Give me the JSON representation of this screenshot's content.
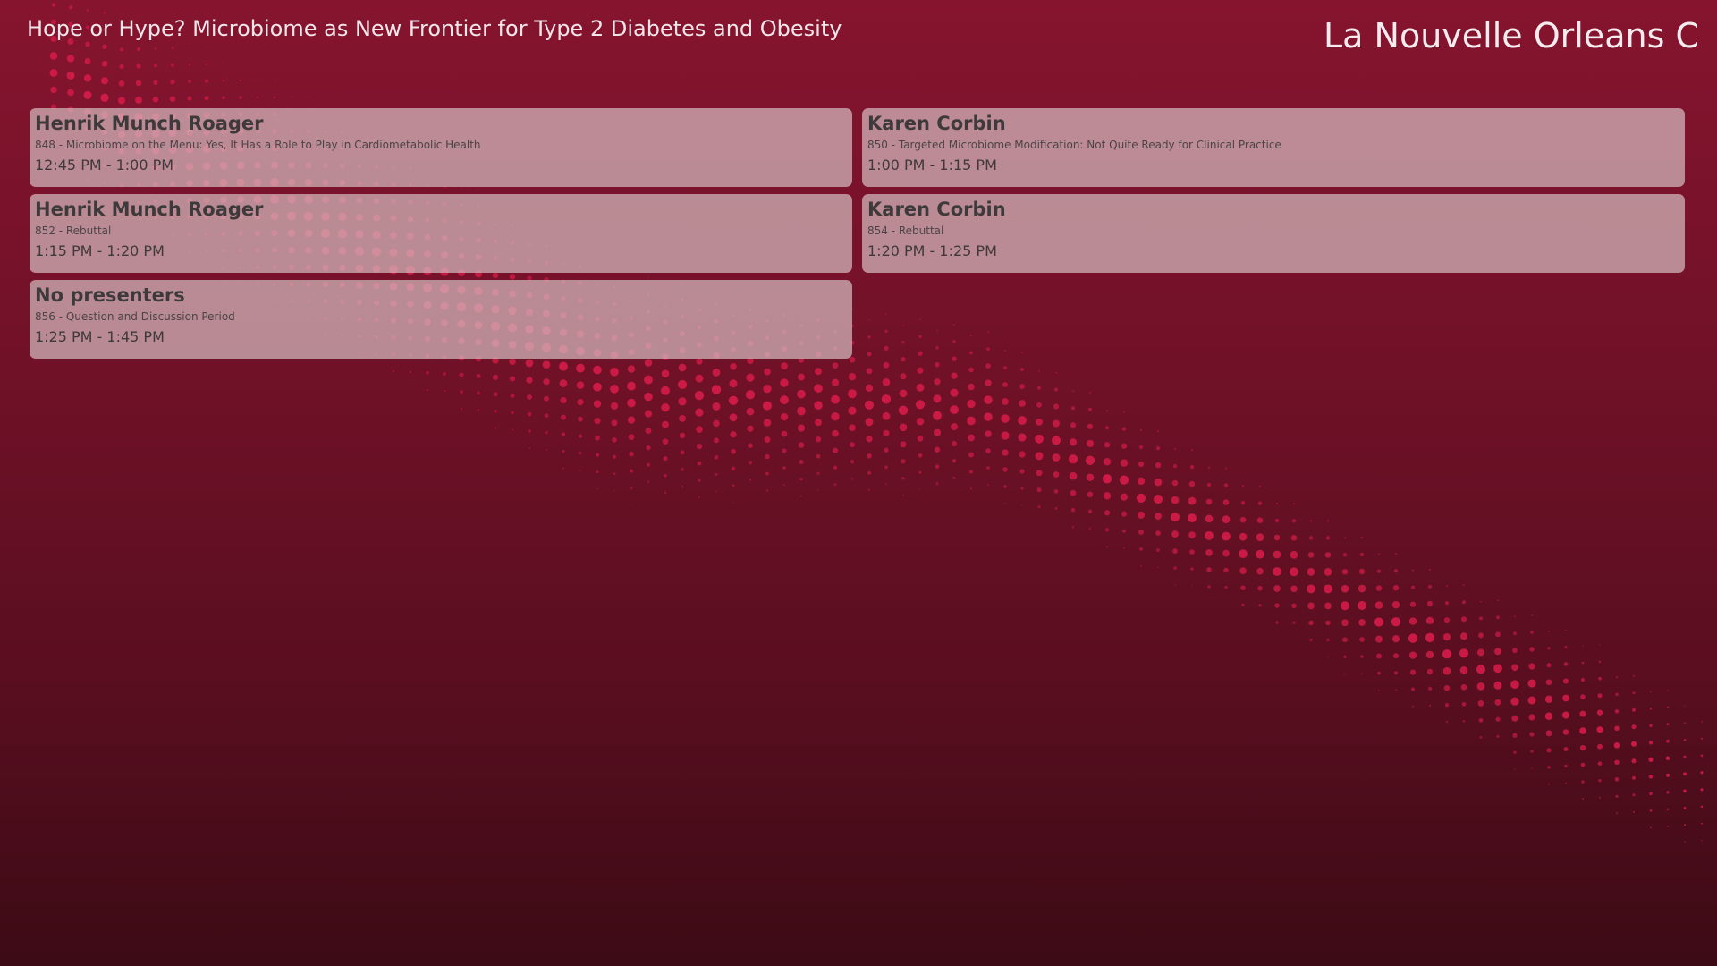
{
  "header": {
    "session_title": "Hope or Hype? Microbiome as New Frontier for Type 2 Diabetes and Obesity",
    "room": "La Nouvelle Orleans C"
  },
  "colors": {
    "background_top": "#86142f",
    "background_bottom": "#3c0b15",
    "dot_accent": "#d81c4a",
    "card_fill": "#d4babe"
  },
  "talks": [
    {
      "presenter": "Henrik Munch Roager",
      "abstract": "848 - Microbiome on the Menu: Yes, It Has a Role to Play in Cardiometabolic Health",
      "time": "12:45 PM - 1:00 PM"
    },
    {
      "presenter": "Karen Corbin",
      "abstract": "850 - Targeted Microbiome Modification: Not Quite Ready for Clinical Practice",
      "time": "1:00 PM - 1:15 PM"
    },
    {
      "presenter": "Henrik Munch Roager",
      "abstract": "852 - Rebuttal",
      "time": "1:15 PM - 1:20 PM"
    },
    {
      "presenter": "Karen Corbin",
      "abstract": "854 - Rebuttal",
      "time": "1:20 PM - 1:25 PM"
    },
    {
      "presenter": "No presenters",
      "abstract": "856 - Question and Discussion Period",
      "time": "1:25 PM - 1:45 PM"
    }
  ]
}
